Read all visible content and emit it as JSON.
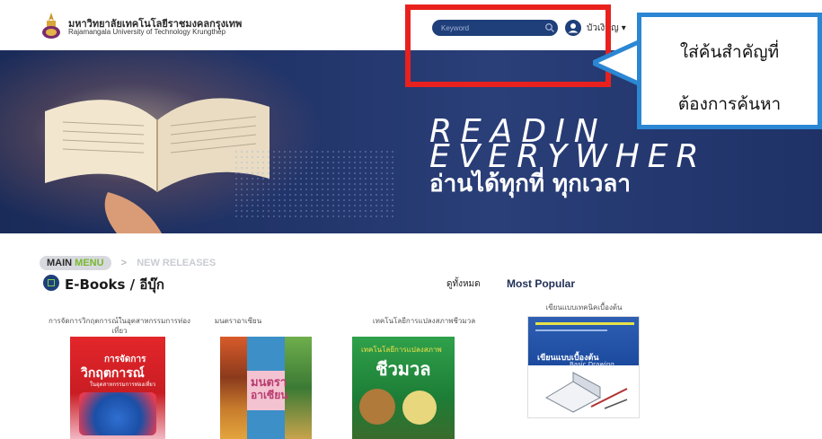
{
  "header": {
    "brand_thai": "มหาวิทยาลัยเทคโนโลยีราชมงคลกรุงเทพ",
    "brand_english": "Rajamangala University of Technology Krungthep",
    "search_placeholder": "Keyword",
    "user_label": "บัวเงินญ ▾"
  },
  "banner": {
    "line1": "READIN",
    "line2": "EVERYWHER",
    "thai_tagline": "อ่านได้ทุกที่ ทุกเวลา"
  },
  "callout": {
    "line1": "ใส่ค้นสำคัญที่",
    "line2": "ต้องการค้นหา",
    "border_color": "#2b87d3",
    "highlight_color": "#e8211e"
  },
  "menu": {
    "main_prefix": "MAIN ",
    "main_accent": "MENU",
    "separator": ">",
    "new_releases": "NEW RELEASES"
  },
  "section": {
    "title": "E-Books / อีบุ๊ก",
    "see_all": "ดูทั้งหมด",
    "popular_title": "Most Popular"
  },
  "books": [
    {
      "title": "การจัดการวิกฤตการณ์ในอุตสาหกรรมการท่องเที่ยว",
      "cover_big": "การจัดการ\nวิกฤตการณ์",
      "cover_small": "ในอุตสาหกรรมการท่องเที่ยว"
    },
    {
      "title": "มนตราอาเซียน",
      "cover_big": "มนตรา\nอาเซียน",
      "cover_small": ""
    },
    {
      "title": "เทคโนโลยีการแปลงสภาพชีวมวล",
      "cover_big": "ชีวมวล",
      "cover_small": "เทคโนโลยีการแปลงสภาพ"
    },
    {
      "title": "เขียนแบบเทคนิคเบื้องต้น",
      "cover_big": "เขียนแบบเบื้องต้น",
      "cover_small": "Basic Drawing"
    }
  ]
}
